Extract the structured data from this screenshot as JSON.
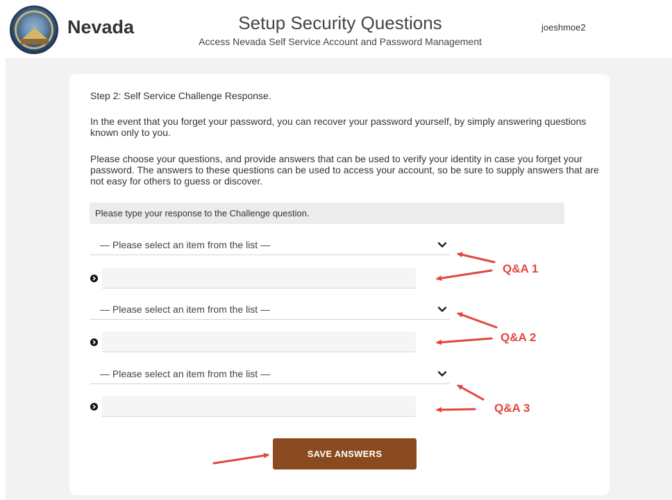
{
  "header": {
    "brand": "Nevada",
    "title": "Setup Security Questions",
    "subtitle": "Access Nevada Self Service Account and Password Management",
    "username": "joeshmoe2"
  },
  "main": {
    "step": "Step 2: Self Service Challenge Response.",
    "paragraph1": "In the event that you forget your password, you can recover your password yourself, by simply answering questions known only to you.",
    "paragraph2": "Please choose your questions, and provide answers that can be used to verify your identity in case you forget your password. The answers to these questions can be used to access your account, so be sure to supply answers that are not easy for others to guess or discover.",
    "instruction": "Please type your response to the Challenge question.",
    "questions": [
      {
        "select_value": "— Please select an item from the list —",
        "answer_value": ""
      },
      {
        "select_value": "— Please select an item from the list —",
        "answer_value": ""
      },
      {
        "select_value": "— Please select an item from the list —",
        "answer_value": ""
      }
    ],
    "save_label": "SAVE ANSWERS"
  },
  "annotations": {
    "labels": [
      "Q&A 1",
      "Q&A 2",
      "Q&A 3"
    ],
    "color": "#e0463c"
  },
  "colors": {
    "save_button": "#8a4a1f",
    "background": "#f2f2f2",
    "instruction_bg": "#ececec"
  },
  "icons": {
    "logo": "nevada-state-seal",
    "dropdown": "chevron-down-icon",
    "bullet": "chevron-right-circle-icon"
  }
}
